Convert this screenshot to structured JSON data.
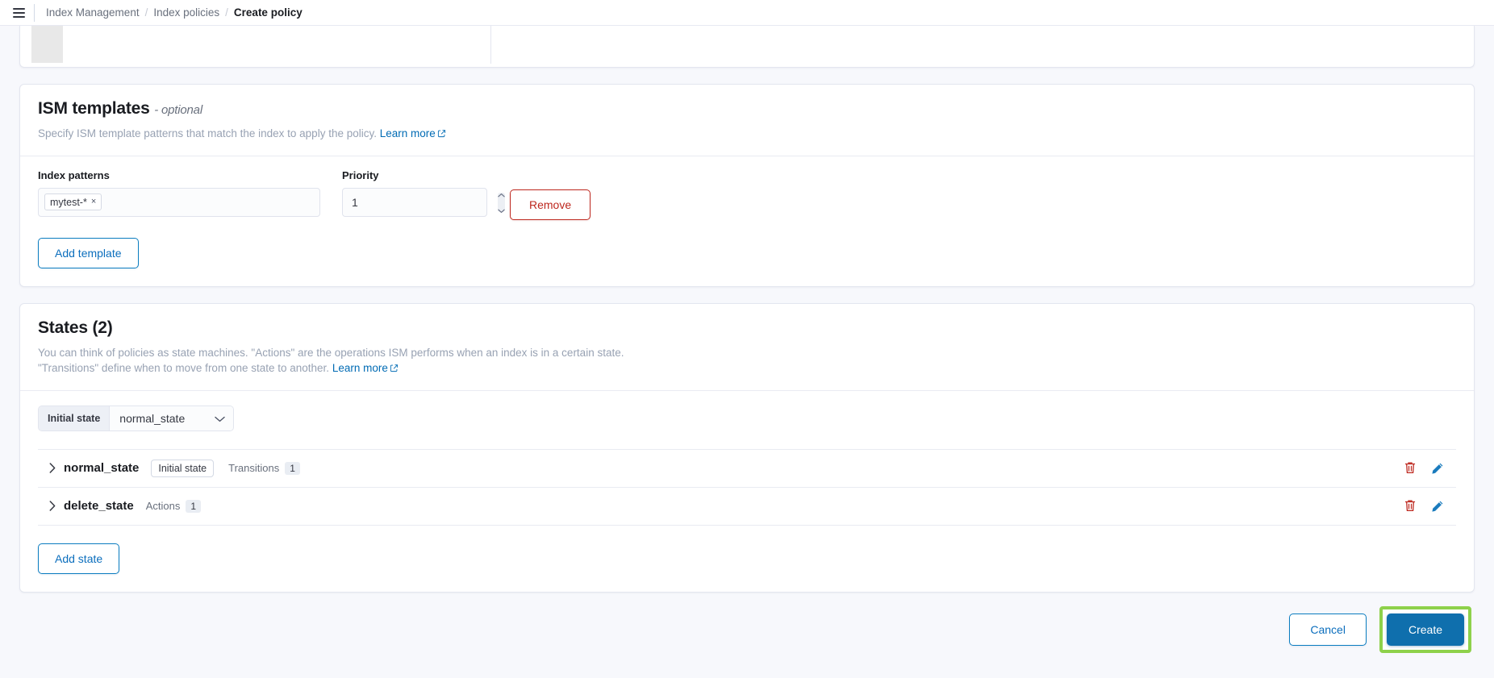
{
  "breadcrumb": {
    "menu_icon": "hamburger-menu-icon",
    "items": [
      {
        "label": "Index Management",
        "active": false
      },
      {
        "label": "Index policies",
        "active": false
      },
      {
        "label": "Create policy",
        "active": true
      }
    ],
    "separator": "/"
  },
  "ism_templates": {
    "title": "ISM templates",
    "title_suffix": "- optional",
    "description": "Specify ISM template patterns that match the index to apply the policy.",
    "learn_more": "Learn more",
    "index_patterns": {
      "label": "Index patterns",
      "pills": [
        {
          "text": "mytest-*",
          "remove": "×"
        }
      ]
    },
    "priority": {
      "label": "Priority",
      "value": "1"
    },
    "remove_button": "Remove",
    "add_template_button": "Add template"
  },
  "states": {
    "title": "States (2)",
    "description_line1": "You can think of policies as state machines. \"Actions\" are the operations ISM performs when an index is in a certain state.",
    "description_line2": "\"Transitions\" define when to move from one state to another.",
    "learn_more": "Learn more",
    "initial_state": {
      "label": "Initial state",
      "value": "normal_state"
    },
    "rows": [
      {
        "name": "normal_state",
        "badge": "Initial state",
        "meta_label": "Transitions",
        "meta_count": "1",
        "delete_icon": "trash-icon",
        "edit_icon": "pencil-icon"
      },
      {
        "name": "delete_state",
        "badge": "",
        "meta_label": "Actions",
        "meta_count": "1",
        "delete_icon": "trash-icon",
        "edit_icon": "pencil-icon"
      }
    ],
    "add_state_button": "Add state"
  },
  "footer": {
    "cancel_button": "Cancel",
    "create_button": "Create"
  },
  "colors": {
    "primary_blue": "#0f6fad",
    "link_blue": "#006bb4",
    "danger_red": "#bd271e",
    "highlight_green": "#8ed14b",
    "page_bg": "#f7f8fc"
  }
}
